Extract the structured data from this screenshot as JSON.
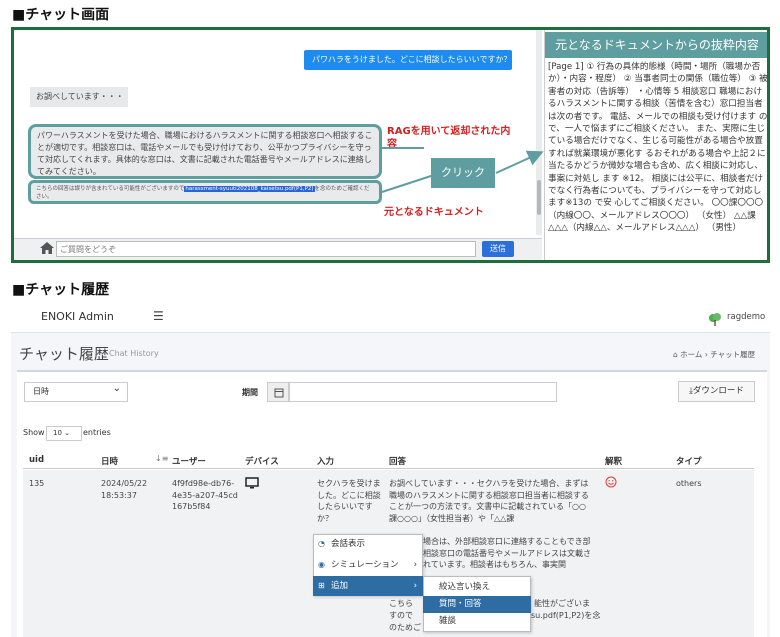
{
  "section1_title": "■チャット画面",
  "section2_title": "■チャット履歴",
  "chat": {
    "user_message": "パワハラをうけました。どこに相談したらいいですか？",
    "waiting_message": "お調べしています・・・",
    "answer_text": "パワーハラスメントを受けた場合、職場におけるハラスメントに関する相談窓口へ相談することが適切です。相談窓口は、電話やメールでも受け付けており、公平かつプライバシーを守って対応してくれます。具体的な窓口は、文書に記載された電話番号やメールアドレスに連絡してみてください。",
    "source_prefix": "こちらの回答は誤りが含まれている可能性がございますので",
    "source_link": "harassment-syuuti202108_kaisetsu.pdf(P1,P2)",
    "source_suffix": "を念のためご確認ください。",
    "input_placeholder": "ご質問をどうぞ",
    "send_label": "送信",
    "rag_label": "RAGを用いて返却された内容",
    "doc_label": "元となるドキュメント",
    "click_label": "クリック",
    "doc_panel_title": "元となるドキュメントからの抜粋内容",
    "doc_excerpt": "[Page 1] ① 行為の具体的態様（時間・場所（職場か否か）・内容・程度） ② 当事者同士の関係（職位等） ③ 被害者の対応（告訴等） ・心情等 5 相談窓口 職場におけるハラスメントに関する相談（苦情を含む）窓口担当者は次の者です。 電話、メールでの相談も受け付けます ので、一人で悩まずにご相談ください。 また、実際に生じている場合だけでなく、生じる可能性がある場合や放置すれば就業環境が悪化す るおそれがある場合や上記２に当たるかどうか微妙な場合も含め、広く相談に対応し、事案に対処し ます ※12。 相談には公平に、相談者だけでなく行為者についても、プライバシーを守って対応します※13の で安 心してご相談ください。 〇〇課〇〇〇（内線〇〇、メールアドレス〇〇〇） （女性） △△課 △△△（内線△△、メールアドレス△△△） （男性）"
  },
  "admin": {
    "brand": "ENOKI Admin",
    "user": "ragdemo",
    "page_title": "チャット履歴",
    "page_subtitle": "Chat History",
    "breadcrumb": "ホーム › チャット履歴",
    "date_select": "日時",
    "period_label": "期間",
    "download_label": "ダウンロード",
    "show_label": "Show",
    "entries_value": "10",
    "entries_label": "entries",
    "columns": [
      "uid",
      "日時",
      "ユーザー",
      "デバイス",
      "入力",
      "回答",
      "解釈",
      "タイプ"
    ],
    "row": {
      "uid": "135",
      "datetime": "2024/05/22 18:53:37",
      "user": "4f9fd98e-db76-4e35-a207-45cd167b5f84",
      "input": "セクハラを受けました。どこに相談したらいいですか？",
      "answer_top": "お調べしています・・・セクハラを受けた場合、まずは職場のハラスメントに関する相談窓口担当者に相談することが一つの方法です。文書中に記載されている「○○課○○○」（女性担当者）や「△△課",
      "answer_right": "場合は、外部相談窓口に連絡することもでき部相談窓口の電話番号やメールアドレスは文載されています。相談者はもちろん、事実関",
      "answer_lower": "こちら",
      "answer_lower2": "能性がございま",
      "answer_lower3": "すので",
      "answer_lower4": "su.pdf(P1,P2)を念",
      "answer_lower5": "のためご",
      "type": "others"
    },
    "context_menu": [
      "会話表示",
      "シミュレーション",
      "追加"
    ],
    "submenu": [
      "絞込言い換え",
      "質問・回答",
      "雑談"
    ]
  }
}
